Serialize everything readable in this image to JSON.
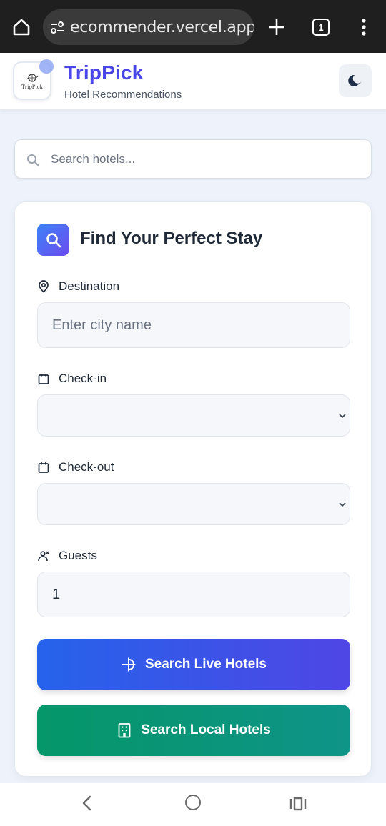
{
  "browser": {
    "url": "ecommender.vercel.app",
    "tab_count": "1",
    "icons": [
      "home-icon",
      "site-settings-icon",
      "new-tab-icon",
      "tab-switcher-icon",
      "more-menu-icon"
    ]
  },
  "header": {
    "logo_text": "TripPick",
    "title": "TripPick",
    "subtitle": "Hotel Recommendations",
    "theme_toggle_icon": "moon-icon"
  },
  "search": {
    "placeholder": "Search hotels..."
  },
  "form": {
    "title": "Find Your Perfect Stay",
    "destination": {
      "label": "Destination",
      "placeholder": "Enter city name",
      "value": ""
    },
    "checkin": {
      "label": "Check-in",
      "value": ""
    },
    "checkout": {
      "label": "Check-out",
      "value": ""
    },
    "guests": {
      "label": "Guests",
      "value": "1"
    },
    "live_button": "Search Live Hotels",
    "local_button": "Search Local Hotels"
  },
  "colors": {
    "brand": "#4b46e8",
    "live_button_start": "#2563eb",
    "live_button_end": "#4f46e5",
    "local_button_start": "#059669",
    "local_button_end": "#0f9488",
    "page_bg": "#eef3fb"
  }
}
